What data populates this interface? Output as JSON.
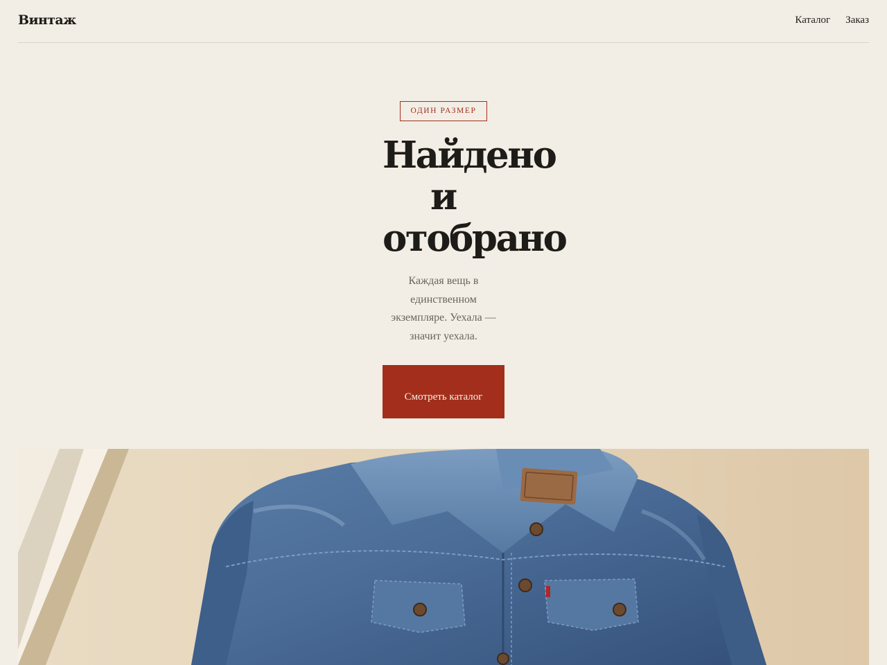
{
  "header": {
    "logo": "Винтаж",
    "nav": [
      {
        "label": "Каталог"
      },
      {
        "label": "Заказ"
      }
    ]
  },
  "hero": {
    "badge": "ОДИН РАЗМЕР",
    "title_lines": [
      "Найдено",
      "и",
      "отобрано"
    ],
    "subtitle": "Каждая вещь в единственном экземпляре. Уехала — значит уехала.",
    "cta_label": "Смотреть каталог"
  },
  "colors": {
    "background": "#f2eee5",
    "accent": "#a32e1c",
    "text": "#1e1c18",
    "muted": "#6a645a"
  }
}
